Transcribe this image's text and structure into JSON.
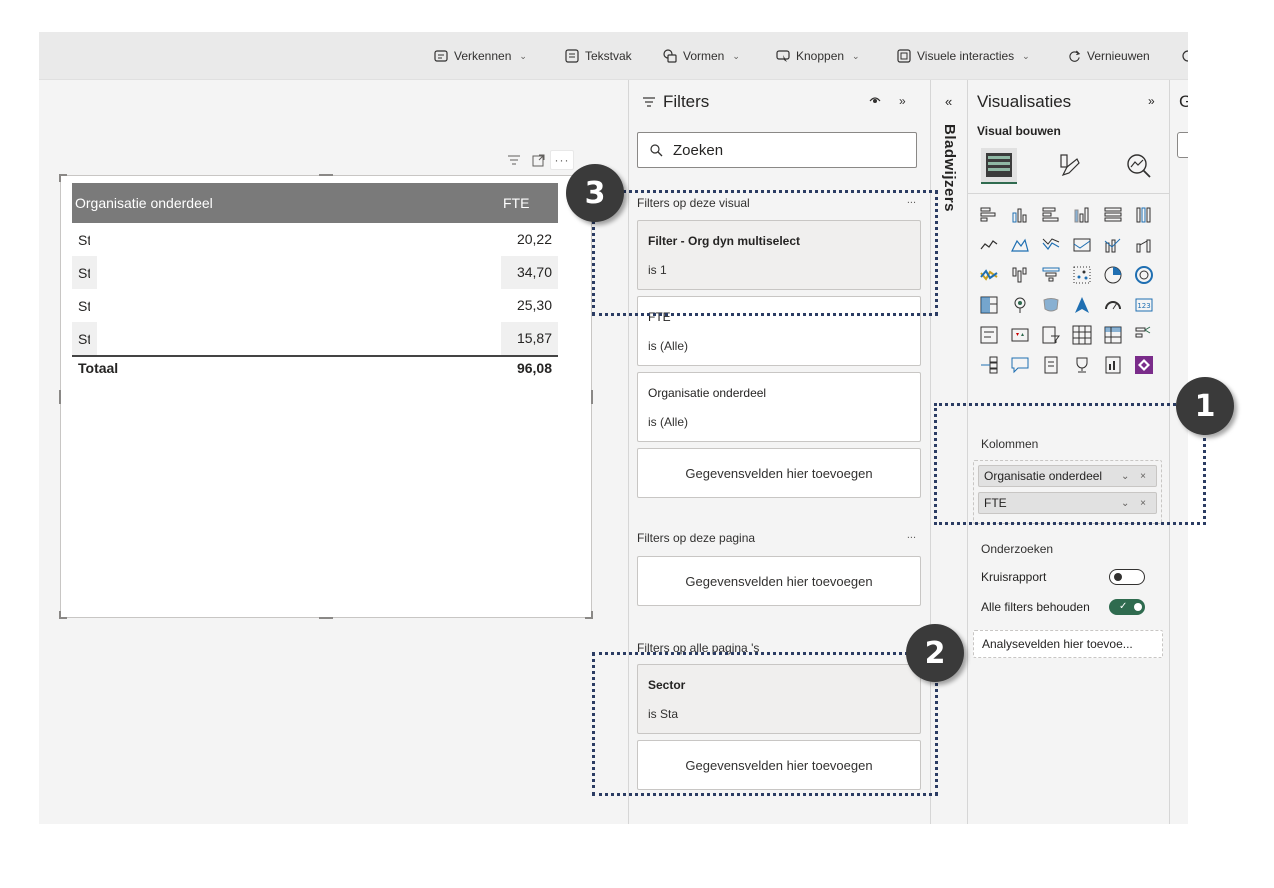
{
  "ribbon": {
    "items": [
      {
        "label": "Verkennen",
        "icon": "explore-icon",
        "has_dropdown": true
      },
      {
        "label": "Tekstvak",
        "icon": "textbox-icon",
        "has_dropdown": false
      },
      {
        "label": "Vormen",
        "icon": "shapes-icon",
        "has_dropdown": true
      },
      {
        "label": "Knoppen",
        "icon": "buttons-icon",
        "has_dropdown": true
      },
      {
        "label": "Visuele interacties",
        "icon": "visual-interactions-icon",
        "has_dropdown": true
      },
      {
        "label": "Vernieuwen",
        "icon": "refresh-icon",
        "has_dropdown": false
      }
    ],
    "chevron": "⌄"
  },
  "visual": {
    "more_label": "···",
    "table": {
      "headers": [
        "Organisatie onderdeel",
        "FTE"
      ],
      "rows": [
        {
          "label": "Sta",
          "value": "20,22"
        },
        {
          "label": "Sta",
          "value": "34,70"
        },
        {
          "label": "Sta",
          "value": "25,30"
        },
        {
          "label": "Sta",
          "value": "15,87"
        }
      ],
      "total_label": "Totaal",
      "total_value": "96,08"
    }
  },
  "filters": {
    "title": "Filters",
    "search_placeholder": "Zoeken",
    "visual_section": "Filters op deze visual",
    "page_section": "Filters op deze pagina",
    "all_pages_section": "Filters op alle pagina 's",
    "more": "...",
    "visual_filters": [
      {
        "name": "Filter - Org dyn multiselect",
        "value": "is 1",
        "bold": true
      },
      {
        "name": "FTE",
        "value": "is (Alle)",
        "bold": false
      },
      {
        "name": "Organisatie onderdeel",
        "value": "is (Alle)",
        "bold": false
      }
    ],
    "all_pages_filters": [
      {
        "name": "Sector",
        "value": "is Sta",
        "bold": true
      }
    ],
    "add_fields": "Gegevensvelden hier toevoegen"
  },
  "bookmarks": {
    "label": "Bladwijzers",
    "collapse": "«"
  },
  "visualizations": {
    "title": "Visualisaties",
    "expand": "»",
    "subtitle": "Visual bouwen",
    "columns_label": "Kolommen",
    "columns": [
      "Organisatie onderdeel",
      "FTE"
    ],
    "chip_controls": "⌄ ×",
    "drill_label": "Onderzoeken",
    "cross_report_label": "Kruisrapport",
    "cross_report_on": false,
    "keep_filters_label": "Alle filters behouden",
    "keep_filters_on": true,
    "drill_fields": "Analysevelden hier toevoe...",
    "accent": "#2f6b4f"
  },
  "next_pane": {
    "letter": "G"
  },
  "annotations": [
    "1",
    "2",
    "3"
  ]
}
